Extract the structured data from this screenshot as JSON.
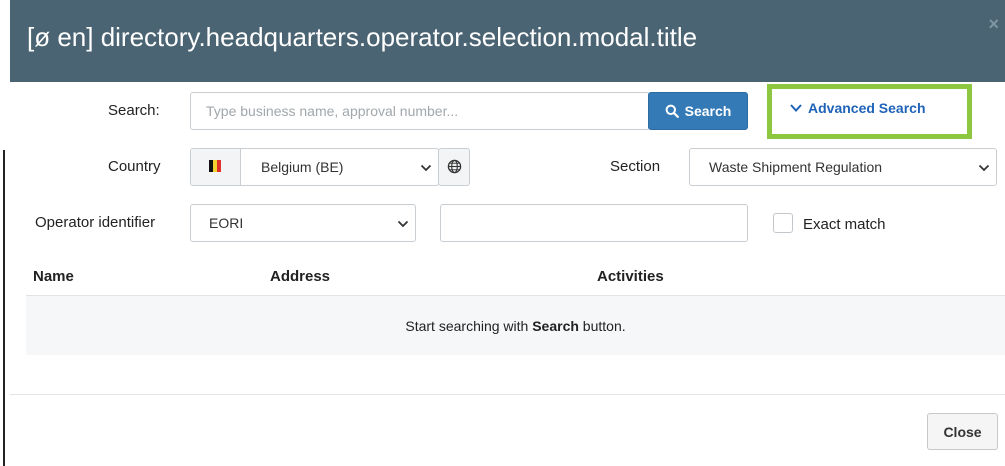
{
  "modal": {
    "title": "[ø en] directory.headquarters.operator.selection.modal.title",
    "close_symbol": "×"
  },
  "search": {
    "label": "Search:",
    "placeholder": "Type business name, approval number...",
    "button_label": "Search",
    "button_icon": "search-icon",
    "advanced_label": "Advanced Search",
    "advanced_icon": "chevron-down-icon"
  },
  "country": {
    "label": "Country",
    "selected": "Belgium (BE)",
    "flag_icon": "belgium-flag-icon",
    "globe_icon": "globe-icon"
  },
  "section": {
    "label": "Section",
    "selected": "Waste Shipment Regulation"
  },
  "operator_identifier": {
    "label": "Operator identifier",
    "selected": "EORI",
    "value": "",
    "exact_match_label": "Exact match",
    "exact_match_checked": false
  },
  "table": {
    "columns": [
      "Name",
      "Address",
      "Activities"
    ],
    "empty_prefix": "Start searching with ",
    "empty_strong": "Search",
    "empty_suffix": " button."
  },
  "footer": {
    "close_label": "Close"
  },
  "colors": {
    "header_bg": "#4b6473",
    "primary": "#337ab7",
    "link": "#1f63b8",
    "highlight": "#8dc63f"
  }
}
